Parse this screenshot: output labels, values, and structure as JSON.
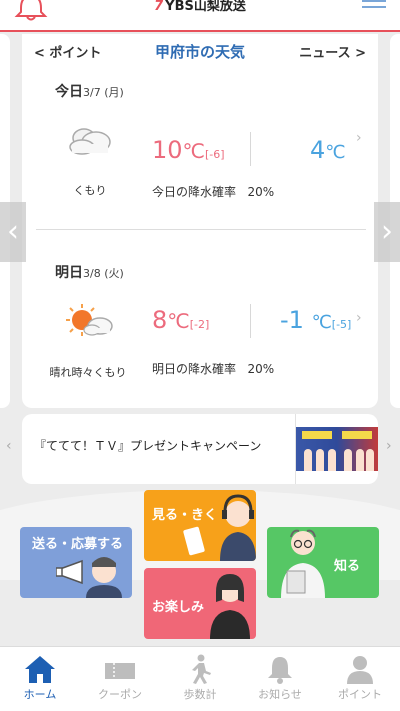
{
  "header": {
    "logo_mark": "7",
    "logo_text": "YBS山梨放送"
  },
  "weather": {
    "prev_label": "< ポイント",
    "title": "甲府市の天気",
    "next_label": "ニュース >",
    "today": {
      "label": "今日",
      "date": "3/7 (月)",
      "condition": "くもり",
      "condition_icon": "cloud-icon",
      "high": "10",
      "high_diff": "[-6]",
      "low": "4",
      "low_diff": "",
      "unit": "℃",
      "rain_label": "今日の降水確率",
      "rain_value": "20%"
    },
    "tomorrow": {
      "label": "明日",
      "date": "3/8 (火)",
      "condition": "晴れ時々くもり",
      "condition_icon": "sun-cloud-icon",
      "high": "8",
      "high_diff": "[-2]",
      "low": "-1",
      "low_diff": "[-5]",
      "unit": "℃",
      "rain_label": "明日の降水確率",
      "rain_value": "20%"
    }
  },
  "banner": {
    "text": "『ててて！ＴＶ』プレゼントキャンペーン"
  },
  "tiles": {
    "send": "送る・応募する",
    "watch": "見る・きく",
    "fun": "お楽しみ",
    "know": "知る"
  },
  "bottom_nav": [
    {
      "label": "ホーム",
      "icon": "home-icon",
      "active": true
    },
    {
      "label": "クーポン",
      "icon": "coupon-icon",
      "active": false
    },
    {
      "label": "歩数計",
      "icon": "walker-icon",
      "active": false
    },
    {
      "label": "お知らせ",
      "icon": "bell-icon",
      "active": false
    },
    {
      "label": "ポイント",
      "icon": "person-icon",
      "active": false
    }
  ],
  "colors": {
    "accent_red": "#e7505a",
    "title_blue": "#2f6cb3",
    "high_temp": "#ec6b7d",
    "low_temp": "#4aa3df",
    "tile_send": "#7f9fd9",
    "tile_watch": "#f7a11a",
    "tile_fun": "#f06777",
    "tile_know": "#56c765"
  }
}
